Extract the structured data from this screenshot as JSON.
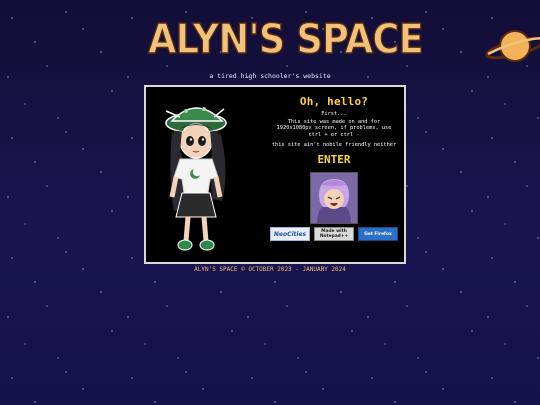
{
  "header": {
    "logo_text": "ALYN'S SPACE",
    "tagline": "a tired high schooler's website"
  },
  "intro": {
    "greeting": "Oh, hello?",
    "first": "First...",
    "notice_line1": "This site was made on and for",
    "notice_line2": "1920x1080px screen, if problems, use",
    "notice_line3": "ctrl + or ctrl -",
    "mobile_note": "this site ain't nobile friendly neither",
    "enter_label": "ENTER"
  },
  "badges": [
    {
      "label": "NeoCities"
    },
    {
      "label": "Made with Notepad++"
    },
    {
      "label": "Get Firefox"
    }
  ],
  "footer": {
    "text": "ALYN'S SPACE © OCTOBER 2023 - JANUARY 2024"
  },
  "colors": {
    "background": "#14103a",
    "logo_fill": "#f1c27a",
    "accent_yellow": "#ffd33a",
    "footer_text": "#f2b97a"
  }
}
